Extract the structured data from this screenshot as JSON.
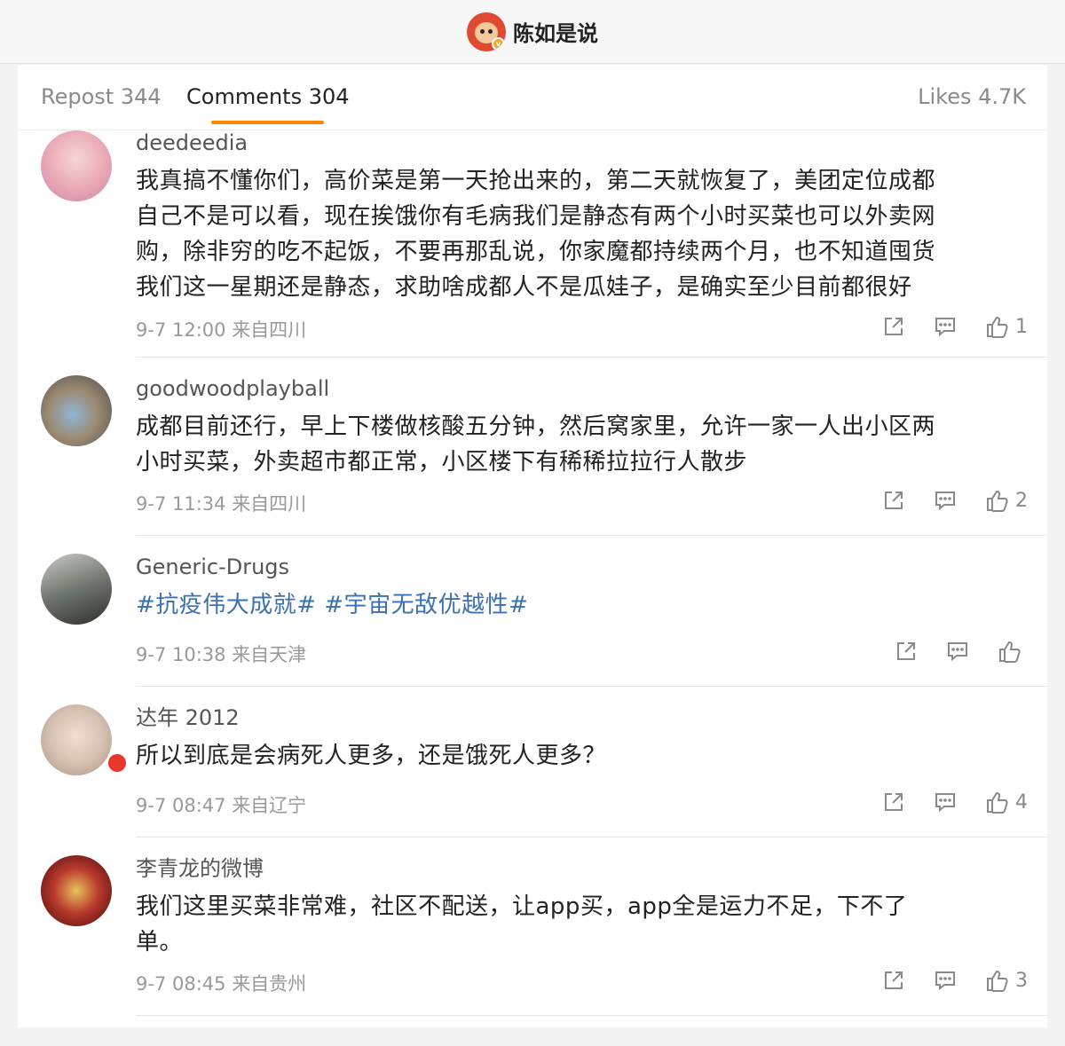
{
  "header": {
    "title": "陈如是说",
    "logo_icon": "monkey-avatar-icon"
  },
  "tabs": {
    "repost": "Repost 344",
    "comments": "Comments 304",
    "likes": "Likes 4.7K"
  },
  "colors": {
    "accent": "#ff8200",
    "hashtag": "#3b70b3"
  },
  "comments": [
    {
      "username": "deedeedia",
      "lines": [
        "我真搞不懂你们，高价菜是第一天抢出来的，第二天就恢复了，美团定位成都",
        "自己不是可以看，现在挨饿你有毛病我们是静态有两个小时买菜也可以外卖网",
        "购，除非穷的吃不起饭，不要再那乱说，你家魔都持续两个月，也不知道囤货",
        "我们这一星期还是静态，求助啥成都人不是瓜娃子，是确实至少目前都很好"
      ],
      "time": "9-7 12:00",
      "location": "来自四川",
      "likes": "1"
    },
    {
      "username": "goodwoodplayball",
      "lines": [
        "成都目前还行，早上下楼做核酸五分钟，然后窝家里，允许一家一人出小区两",
        "小时买菜，外卖超市都正常，小区楼下有稀稀拉拉行人散步"
      ],
      "time": "9-7 11:34",
      "location": "来自四川",
      "likes": "2"
    },
    {
      "username": "Generic-Drugs",
      "hashtags": [
        "#抗疫伟大成就#",
        "#宇宙无敌优越性#"
      ],
      "time": "9-7 10:38",
      "location": "来自天津",
      "likes": ""
    },
    {
      "username": "达年 2012",
      "lines": [
        "所以到底是会病死人更多，还是饿死人更多？"
      ],
      "time": "9-7 08:47",
      "location": "来自辽宁",
      "likes": "4"
    },
    {
      "username": "李青龙的微博",
      "lines": [
        "我们这里买菜非常难，社区不配送，让app买，app全是运力不足，下不了",
        "单。"
      ],
      "time": "9-7 08:45",
      "location": "来自贵州",
      "likes": "3"
    }
  ]
}
